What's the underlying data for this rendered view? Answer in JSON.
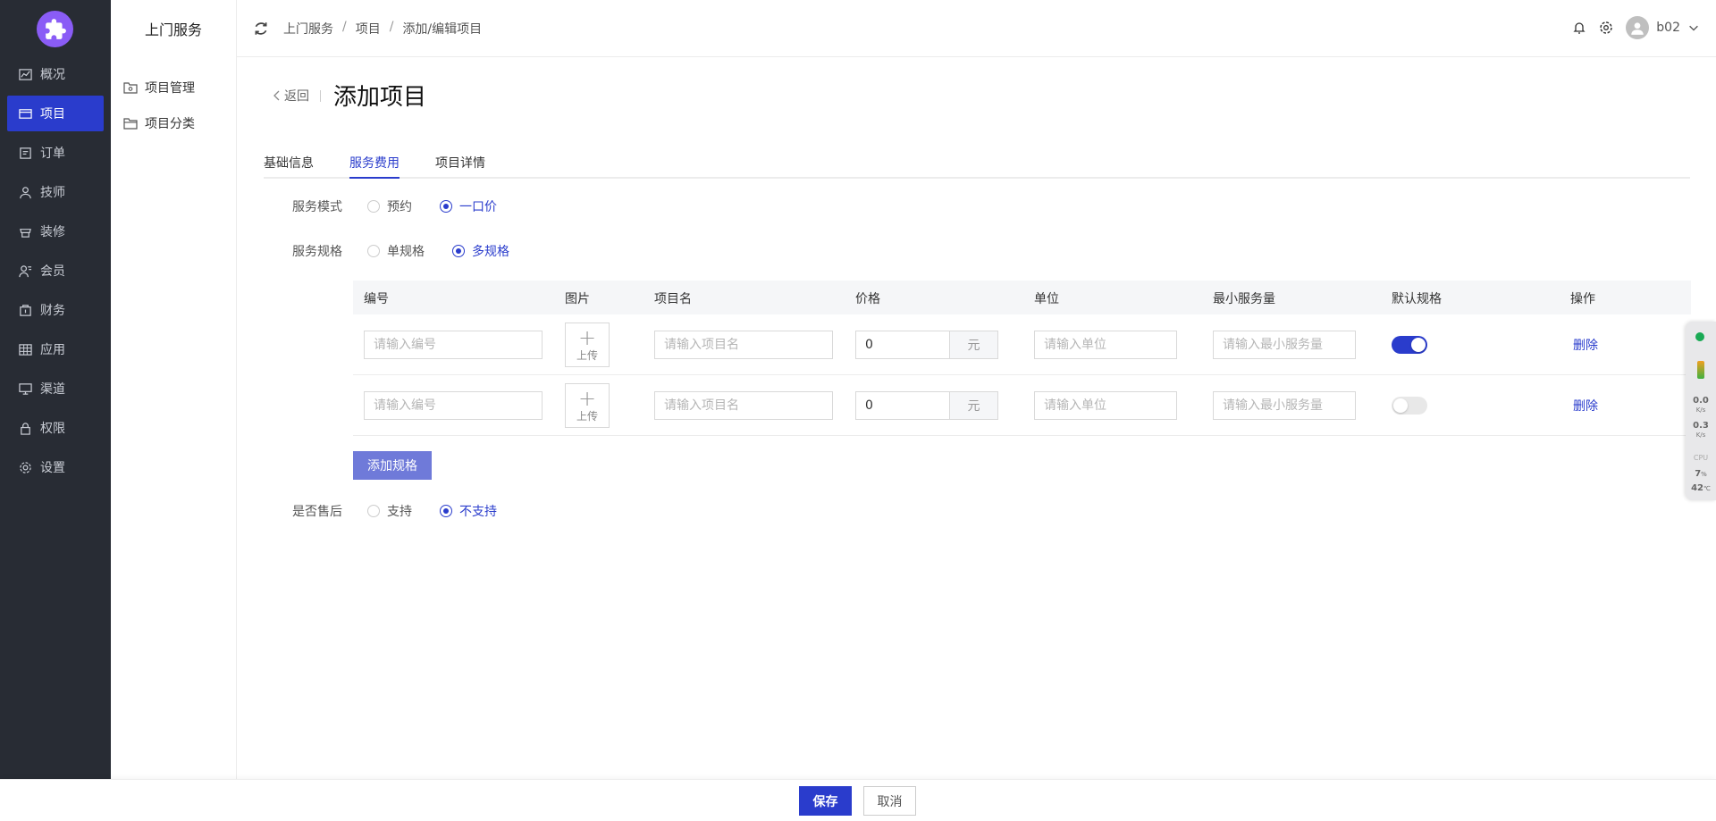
{
  "sidebar": {
    "items": [
      {
        "label": "概况",
        "icon": "chart-line-icon"
      },
      {
        "label": "项目",
        "icon": "card-icon"
      },
      {
        "label": "订单",
        "icon": "order-icon"
      },
      {
        "label": "技师",
        "icon": "user-icon"
      },
      {
        "label": "装修",
        "icon": "shop-icon"
      },
      {
        "label": "会员",
        "icon": "member-icon"
      },
      {
        "label": "财务",
        "icon": "finance-icon"
      },
      {
        "label": "应用",
        "icon": "apps-icon"
      },
      {
        "label": "渠道",
        "icon": "monitor-icon"
      },
      {
        "label": "权限",
        "icon": "lock-icon"
      },
      {
        "label": "设置",
        "icon": "gear-icon"
      }
    ],
    "active_index": 1
  },
  "submenu": {
    "title": "上门服务",
    "items": [
      {
        "label": "项目管理",
        "icon": "folder-gear-icon"
      },
      {
        "label": "项目分类",
        "icon": "folder-icon"
      }
    ]
  },
  "header": {
    "breadcrumbs": [
      "上门服务",
      "项目",
      "添加/编辑项目"
    ],
    "user": "b02"
  },
  "page": {
    "back_label": "返回",
    "title": "添加项目"
  },
  "tabs": [
    {
      "label": "基础信息",
      "active": false
    },
    {
      "label": "服务费用",
      "active": true
    },
    {
      "label": "项目详情",
      "active": false
    }
  ],
  "form": {
    "service_mode": {
      "label": "服务模式",
      "options": [
        "预约",
        "一口价"
      ],
      "selected": "一口价"
    },
    "service_spec": {
      "label": "服务规格",
      "options": [
        "单规格",
        "多规格"
      ],
      "selected": "多规格"
    },
    "after_sale": {
      "label": "是否售后",
      "options": [
        "支持",
        "不支持"
      ],
      "selected": "不支持"
    }
  },
  "table": {
    "headers": [
      "编号",
      "图片",
      "项目名",
      "价格",
      "单位",
      "最小服务量",
      "默认规格",
      "操作"
    ],
    "placeholders": {
      "code": "请输入编号",
      "name": "请输入项目名",
      "unit": "请输入单位",
      "min_qty": "请输入最小服务量"
    },
    "upload_label": "上传",
    "currency": "元",
    "delete_label": "删除",
    "rows": [
      {
        "price": "0",
        "default": true
      },
      {
        "price": "0",
        "default": false
      }
    ]
  },
  "add_spec_label": "添加规格",
  "widget": {
    "net_down": "0.0",
    "net_up": "0.3",
    "net_unit": "K/s",
    "cpu_label": "CPU",
    "cpu_value": "7",
    "cpu_unit": "%",
    "temp_value": "42",
    "temp_unit": "℃"
  },
  "footer": {
    "save_label": "保存",
    "cancel_label": "取消"
  },
  "colors": {
    "primary": "#2a3ccc",
    "sidebar_bg": "#282c34",
    "logo": "#8a5cf6"
  }
}
